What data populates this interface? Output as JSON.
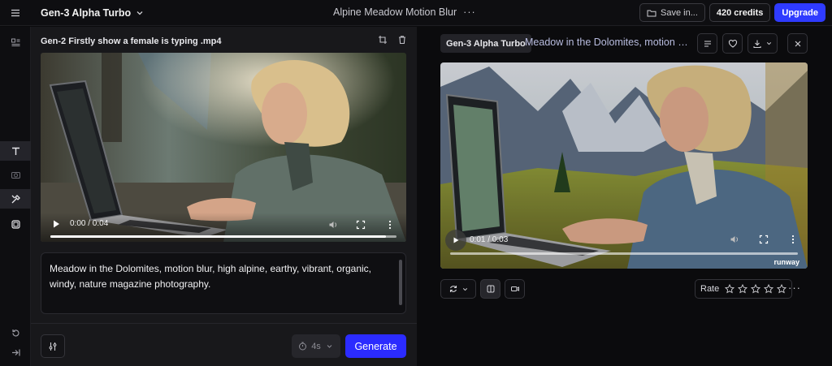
{
  "topbar": {
    "model_name": "Gen-3 Alpha Turbo",
    "project_title": "Alpine Meadow Motion Blur",
    "save_label": "Save in...",
    "credits_label": "420 credits",
    "upgrade_label": "Upgrade"
  },
  "left": {
    "file_title": "Gen-2 Firstly show a female is typing .mp4",
    "video_time": "0:00 / 0:04",
    "video_progress": 0.97,
    "prompt_text": "Meadow in the Dolomites, motion blur, high alpine, earthy, vibrant, organic, windy, nature magazine photography.",
    "duration_label": "4s",
    "generate_label": "Generate"
  },
  "right": {
    "model_tag": "Gen-3 Alpha Turbo",
    "prompt_preview": "Meadow in the Dolomites, motion b...",
    "video_time": "0:01 / 0:03",
    "watermark": "runway",
    "rate_label": "Rate",
    "stars": 5
  },
  "colors": {
    "accent": "#2b2bff",
    "panel": "#18181b",
    "background": "#0b0b0d"
  }
}
